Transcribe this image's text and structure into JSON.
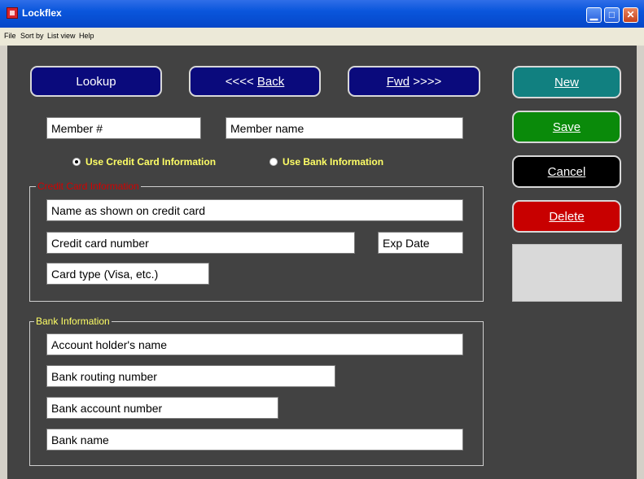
{
  "window": {
    "title": "Lockflex",
    "minimize": "▁",
    "maximize": "□",
    "close": "✕"
  },
  "menu": [
    {
      "label": "File"
    },
    {
      "label": "Sort by"
    },
    {
      "label": "List view"
    },
    {
      "label": "Help"
    }
  ],
  "nav": {
    "lookup": "Lookup",
    "back_prefix": "<<<< ",
    "back_label": "Back",
    "fwd_label": "Fwd",
    "fwd_suffix": " >>>>"
  },
  "actions": {
    "new": "New",
    "save": "Save",
    "cancel": "Cancel",
    "delete": "Delete"
  },
  "member": {
    "number_placeholder": "Member #",
    "name_placeholder": "Member name"
  },
  "payment_options": {
    "credit": {
      "label": "Use Credit Card Information",
      "checked": true
    },
    "bank": {
      "label": "Use Bank Information",
      "checked": false
    }
  },
  "credit_card": {
    "legend": "Credit Card Information",
    "name": "Name as shown on credit card",
    "number": "Credit card number",
    "exp": "Exp Date",
    "type": "Card type (Visa, etc.)"
  },
  "bank": {
    "legend": "Bank Information",
    "holder": "Account holder's name",
    "routing": "Bank routing number",
    "account": "Bank account number",
    "name": "Bank name"
  },
  "colors": {
    "background": "#424242",
    "nav_button": "#0a0a7c",
    "new_button": "#118080",
    "save_button": "#0a8a0a",
    "cancel_button": "#000000",
    "delete_button": "#c80000",
    "credit_legend": "#d40000",
    "bank_legend": "#ffff66",
    "radio_label": "#ffff66"
  }
}
